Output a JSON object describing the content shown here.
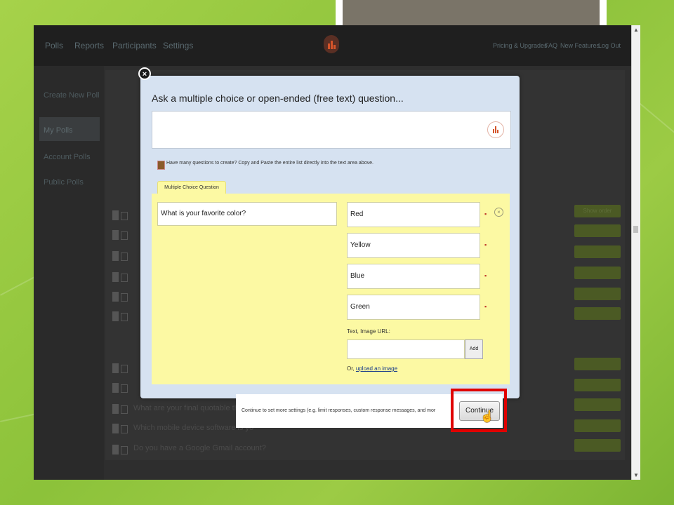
{
  "app": {
    "nav": [
      "Polls",
      "Reports",
      "Participants",
      "Settings"
    ],
    "nav_right": [
      "Pricing & Upgrades",
      "FAQ",
      "New Features",
      "Log Out"
    ]
  },
  "sidebar": {
    "items": [
      "Create New Poll",
      "My Polls",
      "Account Polls",
      "Public Polls"
    ]
  },
  "background_rows": {
    "visible_questions": [
      "What are your final quotable thing",
      "Which mobile device software is yo",
      "Do you have a Google    Gmail account?"
    ],
    "top_button": "Show order"
  },
  "modal": {
    "title": "Ask a multiple choice or open-ended (free text) question...",
    "hint": "Have many questions to create? Copy and Paste the entire list directly into the text area above.",
    "tab_label": "Multiple Choice Question",
    "question_value": "What is your favorite color?",
    "answers": [
      "Red",
      "Yellow",
      "Blue",
      "Green"
    ],
    "url_label": "Text, Image URL:",
    "add_label": "Add",
    "or_text": "Or,",
    "upload_link": "upload an image",
    "bottom_text": "Continue to set more settings (e.g. limit responses, custom response messages, and mor",
    "continue_label": "Continue",
    "close_label": "×"
  },
  "colors": {
    "slide_green": "#9ccb45",
    "modal_blue": "#d6e2f1",
    "panel_yellow": "#fcf9a3",
    "highlight_red": "#e00000",
    "required_red": "#c0392b"
  }
}
